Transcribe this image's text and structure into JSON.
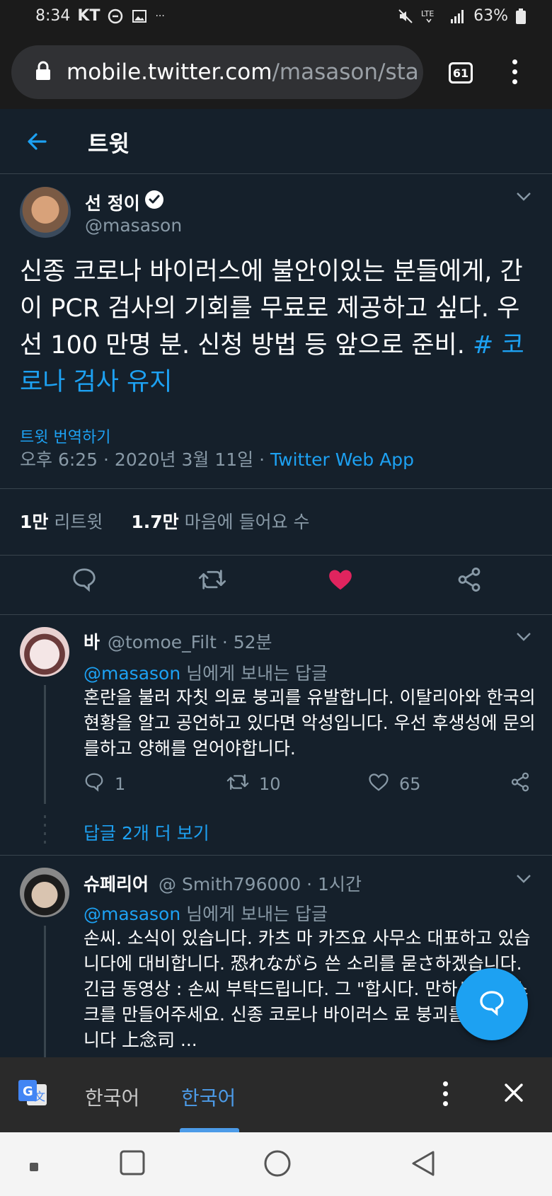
{
  "status_bar": {
    "time": "8:34",
    "carrier": "KT",
    "more": "···",
    "battery": "63%"
  },
  "browser": {
    "url_host": "mobile.twitter.com",
    "url_path": "/masason/sta",
    "tab_count": "61"
  },
  "header": {
    "title": "트윗"
  },
  "tweet": {
    "author_name": "선 정이",
    "author_handle": "@masason",
    "text": "신종 코로나 바이러스에 불안이있는 분들에게, 간이 PCR 검사의 기회를 무료로 제공하고 싶다. 우선 100 만명 분. 신청 방법 등 앞으로 준비.",
    "hashtag": "# 코로나 검사 유지",
    "translate_label": "트윗 번역하기",
    "timestamp": "오후 6:25 · 2020년 3월 11일 · ",
    "source": "Twitter Web App",
    "retweet_count": "1만",
    "retweet_label": "리트윗",
    "like_count": "1.7만",
    "like_label": "마음에 들어요 수"
  },
  "replies": [
    {
      "name": "바",
      "handle": "@tomoe_Filt · 52분",
      "reply_to_handle": "@masason",
      "reply_to_suffix": " 님에게 보내는 답글",
      "text": "혼란을 불러 자칫 의료 붕괴를 유발합니다. 이탈리아와 한국의 현황을 알고 공언하고 있다면 악성입니다. 우선 후생성에 문의를하고 양해를 얻어야합니다.",
      "replies": "1",
      "retweets": "10",
      "likes": "65"
    },
    {
      "name": "슈페리어",
      "handle": "@ Smith796000 · 1시간",
      "reply_to_handle": "@masason",
      "reply_to_suffix": " 님에게 보내는 답글",
      "text": "손씨. 소식이 있습니다. 카츠 마 카즈요 사무소 대표하고 있습니다에 대비합니다. 恐れながら 쓴 소리를 묻さ하겠습니다. 긴급 동영상 : 손씨 부탁드립니다. 그 \"합시다. 만하세요 마스크를 만들어주세요. 신종 코로나 바이러스 료 붕괴를 일으 킵니다 上念司 ..."
    }
  ],
  "more_replies": "답글 2개 더 보기",
  "translate_bar": {
    "source_lang": "한국어",
    "target_lang": "한국어"
  },
  "icons": {
    "back": "arrow-left-icon",
    "verified": "verified-badge-icon",
    "reply": "reply-icon",
    "retweet": "retweet-icon",
    "like": "heart-icon",
    "share": "share-icon",
    "compose": "compose-icon"
  },
  "colors": {
    "background": "#15202b",
    "accent": "#1da1f2",
    "like": "#e0245e",
    "muted": "#8899a6"
  }
}
